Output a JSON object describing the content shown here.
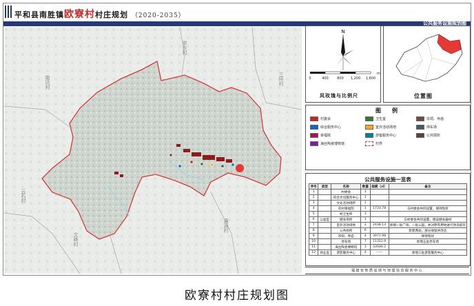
{
  "header": {
    "title_prefix": "平和县南胜镇",
    "title_accent": "欧寮村",
    "title_suffix": "村庄规划",
    "years": "（2020-2035）",
    "section_label": "公共服务设施规划图"
  },
  "map": {
    "neighbors": {
      "top": "崇东村",
      "left": "南坑村",
      "right": "三坪村",
      "bottom_left": "云石村",
      "bottom_mid": "文峰村",
      "bottom_right": "满源村"
    },
    "colors": {
      "boundary": "#d63a3a",
      "terrain": "#cdd4cd",
      "village": "#8b1d1d"
    }
  },
  "compass": {
    "north": "N",
    "scale_labels": [
      "0",
      "400",
      "800",
      "1,200",
      "1,600"
    ],
    "unit": "m",
    "caption": "风玫瑰与比例尺"
  },
  "locator": {
    "caption": "位置图",
    "highlight_color": "#e53935"
  },
  "legend": {
    "title": "图　例",
    "items": [
      {
        "label": "村委会",
        "color": "#c62828"
      },
      {
        "label": "卫生室",
        "color": "#2e7d32"
      },
      {
        "label": "宗祠、寺庙",
        "color": "#6d4c41"
      },
      {
        "label": "综合服务中心",
        "color": "#1565c0"
      },
      {
        "label": "室外活动场地",
        "color": "#f9a825"
      },
      {
        "label": "停车场",
        "color": "#455a64"
      },
      {
        "label": "幸福院",
        "color": "#ad1457"
      },
      {
        "label": "游客服务中心",
        "color": "#00838f"
      },
      {
        "label": "公共厕所",
        "color": "#5d4037"
      },
      {
        "label": "海丝陶瓷博物馆",
        "color": "#7b1fa2"
      },
      {
        "label": "村界",
        "color": "#d63a3a"
      }
    ]
  },
  "facilities_table": {
    "title": "公共服务设施一览表",
    "headers": [
      "序号",
      "类型",
      "名称",
      "数量",
      "规模（㎡）",
      "备注"
    ],
    "rows": [
      [
        "1",
        "",
        "村委会",
        "1",
        "",
        ""
      ],
      [
        "2",
        "",
        "综合文化服务中心",
        "1",
        "",
        ""
      ],
      [
        "3",
        "",
        "文化活动场所",
        "1",
        "",
        ""
      ],
      [
        "4",
        "",
        "农村幸福院",
        "1",
        "1733.78",
        "与村委会共同设置，保持现状"
      ],
      [
        "5",
        "",
        "村卫生所",
        "1",
        "",
        ""
      ],
      [
        "6",
        "公益型",
        "健身场所",
        "1",
        "",
        "与村委会共同设置，增设健身器材"
      ],
      [
        "7",
        "",
        "室外活动场地",
        "2",
        "2438.13",
        "新建一处广场，一处公园，并对原有用地进行改造提升"
      ],
      [
        "8",
        "",
        "公共厕所",
        "6",
        "",
        "新建两处，部分保留并改造"
      ],
      [
        "9",
        "",
        "宗祠、寺庙",
        "4",
        "3971.98",
        "保持现状"
      ],
      [
        "10",
        "",
        "停车场",
        "7",
        "11312.9",
        "新增五处停车场"
      ],
      [
        "11",
        "",
        "海丝陶瓷博物馆",
        "1",
        "33500.2",
        ""
      ],
      [
        "12",
        "商业型",
        "游客服务中心",
        "4",
        "——",
        "新增三处游客服务中心"
      ]
    ]
  },
  "footer": {
    "org": "福建省地质遥感与地理信息服务中心"
  },
  "caption": "欧寮村村庄规划图"
}
